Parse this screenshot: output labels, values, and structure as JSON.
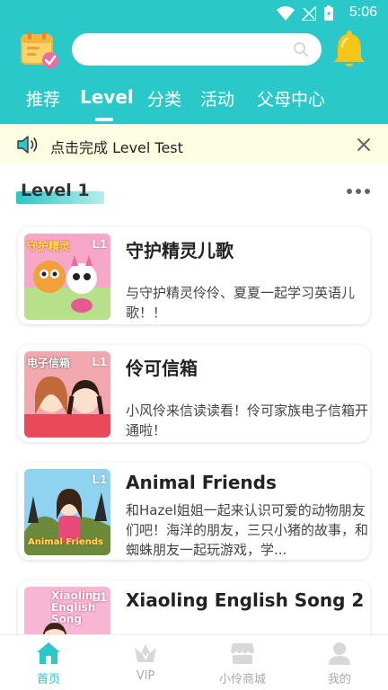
{
  "status": {
    "time": "5:06"
  },
  "search": {
    "placeholder": ""
  },
  "tabs": [
    "推荐",
    "Level",
    "分类",
    "活动",
    "父母中心"
  ],
  "active_tab": "Level",
  "notice": {
    "text": "点击完成 Level Test"
  },
  "section": {
    "title": "Level 1"
  },
  "cards": [
    {
      "title": "守护精灵儿歌",
      "badge": "L1",
      "thumb_text": "守护精灵",
      "desc": "与守护精灵伶伶、夏夏一起学习英语儿歌！！"
    },
    {
      "title": "伶可信箱",
      "badge": "L1",
      "thumb_text": "电子信箱",
      "desc": "小风伶来信读读看！伶可家族电子信箱开通啦！"
    },
    {
      "title": "Animal Friends",
      "badge": "L1",
      "thumb_text": "Animal Friends",
      "desc": "和Hazel姐姐一起来认识可爱的动物朋友们吧！海洋的朋友，三只小猪的故事，和蜘蛛朋友一起玩游戏，学..."
    },
    {
      "title": "Xiaoling English Song 2",
      "badge": "L1",
      "thumb_text": "Xiaoling English Song",
      "desc": ""
    }
  ],
  "bottom_nav": [
    {
      "label": "首页",
      "icon": "home-icon"
    },
    {
      "label": "VIP",
      "icon": "crown-icon"
    },
    {
      "label": "小伶商城",
      "icon": "shop-icon"
    },
    {
      "label": "我的",
      "icon": "user-icon"
    }
  ],
  "colors": {
    "primary": "#2ac8c8",
    "notice_bg": "#fdfde2",
    "bell": "#f5c518"
  }
}
